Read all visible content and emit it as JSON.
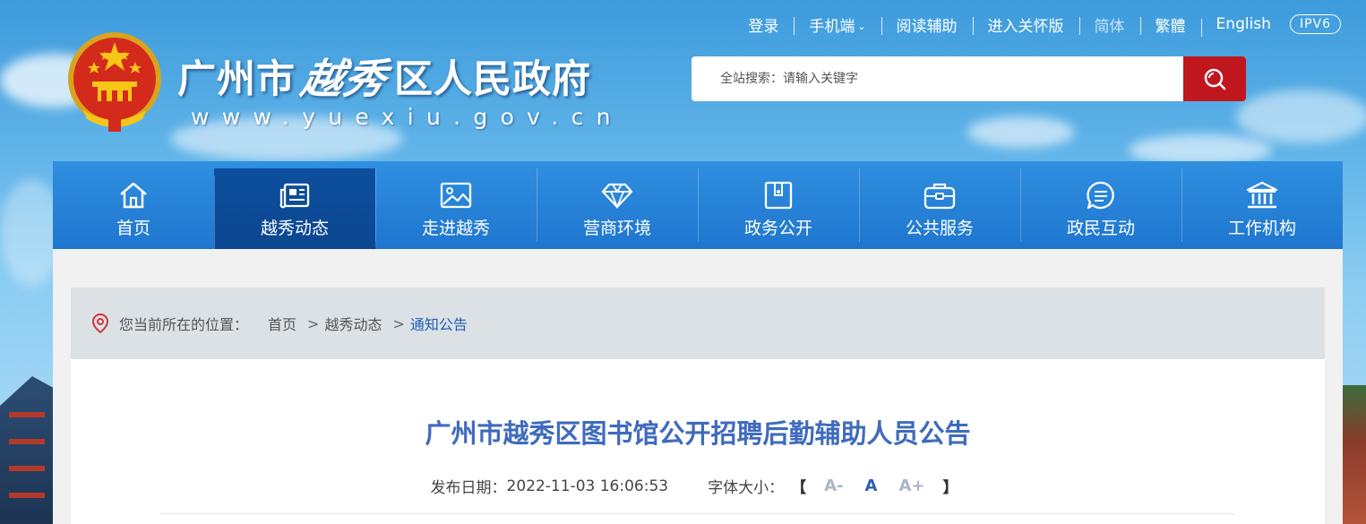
{
  "header": {
    "site_name_prefix": "广州市",
    "site_name_calligraphy": "越秀",
    "site_name_suffix": "区人民政府",
    "site_url": "www.yuexiu.gov.cn"
  },
  "top_links": {
    "login": "登录",
    "mobile": "手机端",
    "reading_aid": "阅读辅助",
    "care_mode": "进入关怀版",
    "simplified": "简体",
    "traditional": "繁體",
    "english": "English",
    "ipv6": "IPV6"
  },
  "search": {
    "placeholder": "全站搜索：请输入关键字"
  },
  "nav": {
    "items": [
      {
        "label": "首页",
        "icon": "home-icon"
      },
      {
        "label": "越秀动态",
        "icon": "newspaper-icon"
      },
      {
        "label": "走进越秀",
        "icon": "picture-icon"
      },
      {
        "label": "营商环境",
        "icon": "diamond-icon"
      },
      {
        "label": "政务公开",
        "icon": "folder-icon"
      },
      {
        "label": "公共服务",
        "icon": "briefcase-icon"
      },
      {
        "label": "政民互动",
        "icon": "chat-icon"
      },
      {
        "label": "工作机构",
        "icon": "institution-icon"
      }
    ],
    "active_index": 1
  },
  "breadcrumb": {
    "prefix": "您当前所在的位置：",
    "items": [
      "首页",
      "越秀动态",
      "通知公告"
    ],
    "separator": ">"
  },
  "article": {
    "title": "广州市越秀区图书馆公开招聘后勤辅助人员公告",
    "date_label": "发布日期：",
    "date_value": "2022-11-03 16:06:53",
    "font_size_label": "字体大小：",
    "bracket_open": "【",
    "bracket_close": "】",
    "font_small": "A-",
    "font_medium": "A",
    "font_large": "A+"
  },
  "colors": {
    "nav_blue": "#1f76cf",
    "nav_active": "#0b4690",
    "search_button": "#c0161e",
    "title_blue": "#3f6bbd"
  }
}
